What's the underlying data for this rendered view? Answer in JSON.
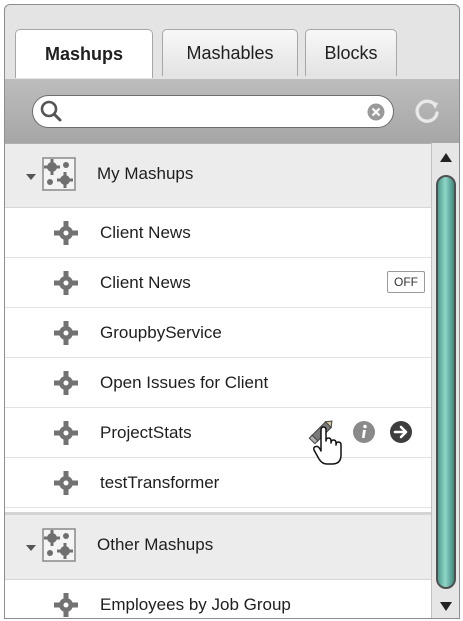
{
  "tabs": [
    {
      "label": "Mashups",
      "active": true
    },
    {
      "label": "Mashables",
      "active": false
    },
    {
      "label": "Blocks",
      "active": false
    }
  ],
  "search": {
    "value": "",
    "placeholder": ""
  },
  "groups": [
    {
      "label": "My Mashups",
      "expanded": true,
      "items": [
        {
          "label": "Client News"
        },
        {
          "label": "Client News",
          "badge": "OFF"
        },
        {
          "label": "GroupbyService"
        },
        {
          "label": "Open Issues for Client"
        },
        {
          "label": "ProjectStats",
          "hovered": true
        },
        {
          "label": "testTransformer"
        }
      ]
    },
    {
      "label": "Other Mashups",
      "expanded": true,
      "items": [
        {
          "label": "Employees by Job Group"
        }
      ]
    }
  ],
  "icons": {
    "search": "search-icon",
    "clear": "clear-search-icon",
    "refresh": "refresh-icon",
    "group": "mashup-group-icon",
    "item": "gear-icon",
    "edit": "pencil-icon",
    "info": "info-icon",
    "open": "arrow-right-icon",
    "cursor": "hand-cursor-icon"
  },
  "colors": {
    "scroll_thumb": "#6fbcae",
    "toolbar": "#b0b0b0",
    "group_header": "#ececec"
  }
}
